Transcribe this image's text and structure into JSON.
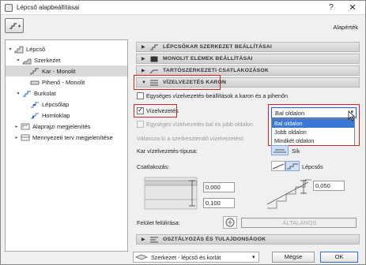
{
  "window": {
    "title": "Lépcső alapbeállításai"
  },
  "header": {
    "default_label": "Alapérték"
  },
  "tree": [
    {
      "label": "Lépcső",
      "level": 0,
      "arrow": "▾",
      "icon": "stair-icon",
      "selected": false
    },
    {
      "label": "Szerkezet",
      "level": 1,
      "arrow": "▾",
      "icon": "structure-icon",
      "selected": false
    },
    {
      "label": "Kar - Monolit",
      "level": 2,
      "arrow": "",
      "icon": "flight-icon",
      "selected": true
    },
    {
      "label": "Pihenő - Monolit",
      "level": 2,
      "arrow": "",
      "icon": "landing-icon",
      "selected": false
    },
    {
      "label": "Burkolat",
      "level": 1,
      "arrow": "▾",
      "icon": "finish-icon",
      "selected": false
    },
    {
      "label": "Lépcsőlap",
      "level": 2,
      "arrow": "",
      "icon": "tread-icon",
      "selected": false
    },
    {
      "label": "Homloklap",
      "level": 2,
      "arrow": "",
      "icon": "riser-icon",
      "selected": false
    },
    {
      "label": "Alaprajzi megjelenítés",
      "level": 0,
      "arrow": "▸",
      "icon": "floorplan-icon",
      "selected": false
    },
    {
      "label": "Mennyezeti terv megjelenítése",
      "level": 0,
      "arrow": "▸",
      "icon": "ceiling-icon",
      "selected": false
    }
  ],
  "sections": {
    "s1": "LÉPCSŐKAR SZERKEZET BEÁLLÍTÁSAI",
    "s2": "MONOLIT ELEMEK BEÁLLÍTÁSAI",
    "s3": "TARTÓSZERKEZETI CSATLAKOZÁSOK",
    "s4": "VÍZELVEZETÉS KARON",
    "s5": "OSZTÁLYOZÁS ÉS TULAJDONSÁGOK"
  },
  "drainage": {
    "uniform_label": "Egységes vízelvezetés-beállítások a karon és a pihenőn",
    "drainage_label": "Vízelvezetés",
    "side_select_value": "Bal oldalon",
    "side_options": [
      "Bal oldalon",
      "Jobb oldalon",
      "Mindkét oldalon"
    ],
    "uniform_lr_label": "Egységes vízelvezetés bal és jobb oldalon",
    "choose_label": "Válassza ki a szerkesztendő vízelvezetést:",
    "type_label": "Kar vízelvezetés-típusa:",
    "type_value": "Sík",
    "connection_label": "Csatlakozás:",
    "connection_value": "Lépcsős",
    "input_a": "0,000",
    "input_b": "0,100",
    "input_c": "0,050",
    "surface_label": "Felület felülírása:",
    "surface_value": "ÁLTALÁNOS"
  },
  "footer": {
    "layer_value": "Szerkezet - lépcső és korlát",
    "cancel_label": "Mégse",
    "ok_label": "OK"
  }
}
